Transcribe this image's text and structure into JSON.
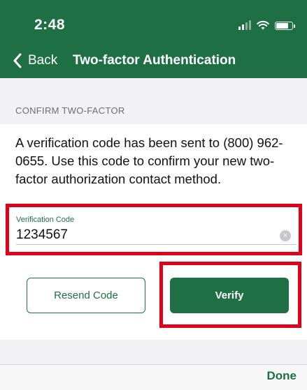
{
  "status_bar": {
    "time": "2:48"
  },
  "nav": {
    "back_label": "Back",
    "title": "Two-factor Authentication"
  },
  "section": {
    "label": "CONFIRM TWO-FACTOR"
  },
  "message": {
    "prefix": "A verification code has been sent to ",
    "phone": "(800) 962-0655",
    "suffix": ". Use this code to confirm your new two-factor authorization contact method."
  },
  "field": {
    "label": "Verification Code",
    "value": "1234567",
    "clear_glyph": "×"
  },
  "buttons": {
    "resend_label": "Resend Code",
    "verify_label": "Verify"
  },
  "toolbar": {
    "done_label": "Done"
  },
  "colors": {
    "brand_green": "#1f6f45",
    "highlight_red": "#e0001b",
    "background_gray": "#f2f2f4"
  }
}
